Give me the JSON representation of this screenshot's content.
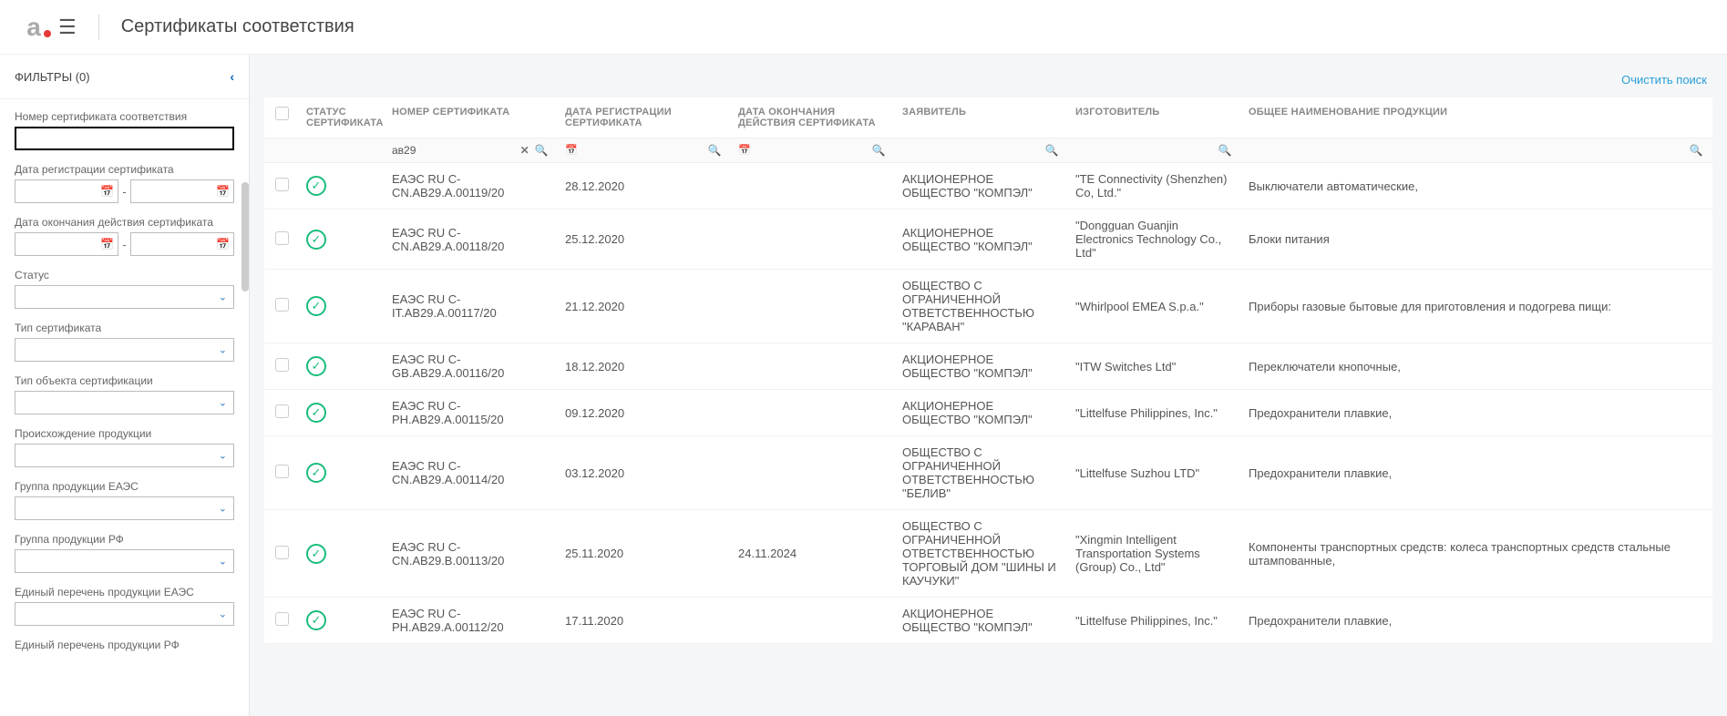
{
  "header": {
    "logo_letter": "a",
    "page_title": "Сертификаты соответствия"
  },
  "sidebar": {
    "filters_title": "ФИЛЬТРЫ (0)",
    "fields": {
      "cert_number_label": "Номер сертификата соответствия",
      "reg_date_label": "Дата регистрации сертификата",
      "exp_date_label": "Дата окончания действия сертификата",
      "status_label": "Статус",
      "cert_type_label": "Тип сертификата",
      "object_type_label": "Тип объекта сертификации",
      "origin_label": "Происхождение продукции",
      "group_eaes_label": "Группа продукции ЕАЭС",
      "group_rf_label": "Группа продукции РФ",
      "unified_eaes_label": "Единый перечень продукции ЕАЭС",
      "unified_rf_label": "Единый перечень продукции РФ"
    },
    "date_separator": "-"
  },
  "toolbar": {
    "clear_search": "Очистить поиск"
  },
  "table": {
    "columns": {
      "status": "СТАТУС СЕРТИФИКАТА",
      "number": "НОМЕР СЕРТИФИКАТА",
      "reg_date": "ДАТА РЕГИСТРАЦИИ СЕРТИФИКАТА",
      "exp_date": "ДАТА ОКОНЧАНИЯ ДЕЙСТВИЯ СЕРТИФИКАТА",
      "applicant": "ЗАЯВИТЕЛЬ",
      "manufacturer": "ИЗГОТОВИТЕЛЬ",
      "product": "ОБЩЕЕ НАИМЕНОВАНИЕ ПРОДУКЦИИ"
    },
    "filter_number_value": "ав29",
    "rows": [
      {
        "number": "ЕАЭС RU С-CN.АВ29.А.00119/20",
        "reg_date": "28.12.2020",
        "exp_date": "",
        "applicant": "АКЦИОНЕРНОЕ ОБЩЕСТВО \"КОМПЭЛ\"",
        "manufacturer": "\"TE Connectivity (Shenzhen) Co, Ltd.\"",
        "product": "Выключатели автоматические,"
      },
      {
        "number": "ЕАЭС RU С-CN.АВ29.А.00118/20",
        "reg_date": "25.12.2020",
        "exp_date": "",
        "applicant": "АКЦИОНЕРНОЕ ОБЩЕСТВО \"КОМПЭЛ\"",
        "manufacturer": "\"Dongguan Guanjin Electronics Technology Co., Ltd\"",
        "product": "Блоки питания"
      },
      {
        "number": "ЕАЭС RU С-IT.АВ29.А.00117/20",
        "reg_date": "21.12.2020",
        "exp_date": "",
        "applicant": "ОБЩЕСТВО С ОГРАНИЧЕННОЙ ОТВЕТСТВЕННОСТЬЮ \"КАРАВАН\"",
        "manufacturer": "\"Whirlpool EMEA S.p.a.\"",
        "product": "Приборы газовые бытовые для приготовления и подогрева пищи:"
      },
      {
        "number": "ЕАЭС RU С-GB.АВ29.А.00116/20",
        "reg_date": "18.12.2020",
        "exp_date": "",
        "applicant": "АКЦИОНЕРНОЕ ОБЩЕСТВО \"КОМПЭЛ\"",
        "manufacturer": "\"ITW Switches Ltd\"",
        "product": "Переключатели кнопочные,"
      },
      {
        "number": "ЕАЭС RU С-PH.АВ29.А.00115/20",
        "reg_date": "09.12.2020",
        "exp_date": "",
        "applicant": "АКЦИОНЕРНОЕ ОБЩЕСТВО \"КОМПЭЛ\"",
        "manufacturer": "\"Littelfuse Philippines, Inc.\"",
        "product": "Предохранители плавкие,"
      },
      {
        "number": "ЕАЭС RU С-CN.АВ29.А.00114/20",
        "reg_date": "03.12.2020",
        "exp_date": "",
        "applicant": "ОБЩЕСТВО С ОГРАНИЧЕННОЙ ОТВЕТСТВЕННОСТЬЮ \"БЕЛИВ\"",
        "manufacturer": "\"Littelfuse Suzhou LTD\"",
        "product": "Предохранители плавкие,"
      },
      {
        "number": "ЕАЭС RU С-CN.АВ29.В.00113/20",
        "reg_date": "25.11.2020",
        "exp_date": "24.11.2024",
        "applicant": "ОБЩЕСТВО С ОГРАНИЧЕННОЙ ОТВЕТСТВЕННОСТЬЮ ТОРГОВЫЙ ДОМ \"ШИНЫ И КАУЧУКИ\"",
        "manufacturer": "\"Xingmin Intelligent Transportation Systems (Group) Co., Ltd\"",
        "product": "Компоненты транспортных средств: колеса транспортных средств стальные штампованные,"
      },
      {
        "number": "ЕАЭС RU С-PH.АВ29.А.00112/20",
        "reg_date": "17.11.2020",
        "exp_date": "",
        "applicant": "АКЦИОНЕРНОЕ ОБЩЕСТВО \"КОМПЭЛ\"",
        "manufacturer": "\"Littelfuse Philippines, Inc.\"",
        "product": "Предохранители плавкие,"
      }
    ]
  }
}
